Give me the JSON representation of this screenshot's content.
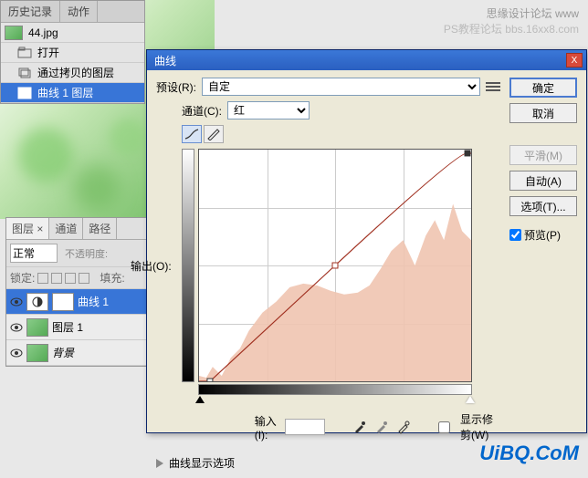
{
  "watermark": {
    "line1": "思缘设计论坛 www",
    "line2": "bbs.16xx8.com",
    "brand": "PS教程论坛"
  },
  "uibq": "UiBQ.CoM",
  "history": {
    "tabs": [
      "历史记录",
      "动作"
    ],
    "file": "44.jpg",
    "items": [
      {
        "label": "打开"
      },
      {
        "label": "通过拷贝的图层"
      },
      {
        "label": "曲线 1 图层",
        "selected": true
      }
    ]
  },
  "layers": {
    "tabs": [
      "图层 ×",
      "通道",
      "路径"
    ],
    "blend": "正常",
    "opacity_label": "不透明度:",
    "lock_label": "锁定:",
    "fill_label": "填充:",
    "items": [
      {
        "name": "曲线 1",
        "selected": true,
        "type": "adjustment"
      },
      {
        "name": "图层 1",
        "type": "layer"
      },
      {
        "name": "背景",
        "type": "background",
        "italic": true
      }
    ]
  },
  "dialog": {
    "title": "曲线",
    "close": "X",
    "preset_label": "预设(R):",
    "preset_value": "自定",
    "channel_label": "通道(C):",
    "channel_value": "红",
    "output_label": "输出(O):",
    "input_label": "输入(I):",
    "show_clip": "显示修剪(W)",
    "expand": "曲线显示选项",
    "buttons": {
      "ok": "确定",
      "cancel": "取消",
      "smooth": "平滑(M)",
      "auto": "自动(A)",
      "options": "选项(T)..."
    },
    "preview": "预览(P)"
  }
}
